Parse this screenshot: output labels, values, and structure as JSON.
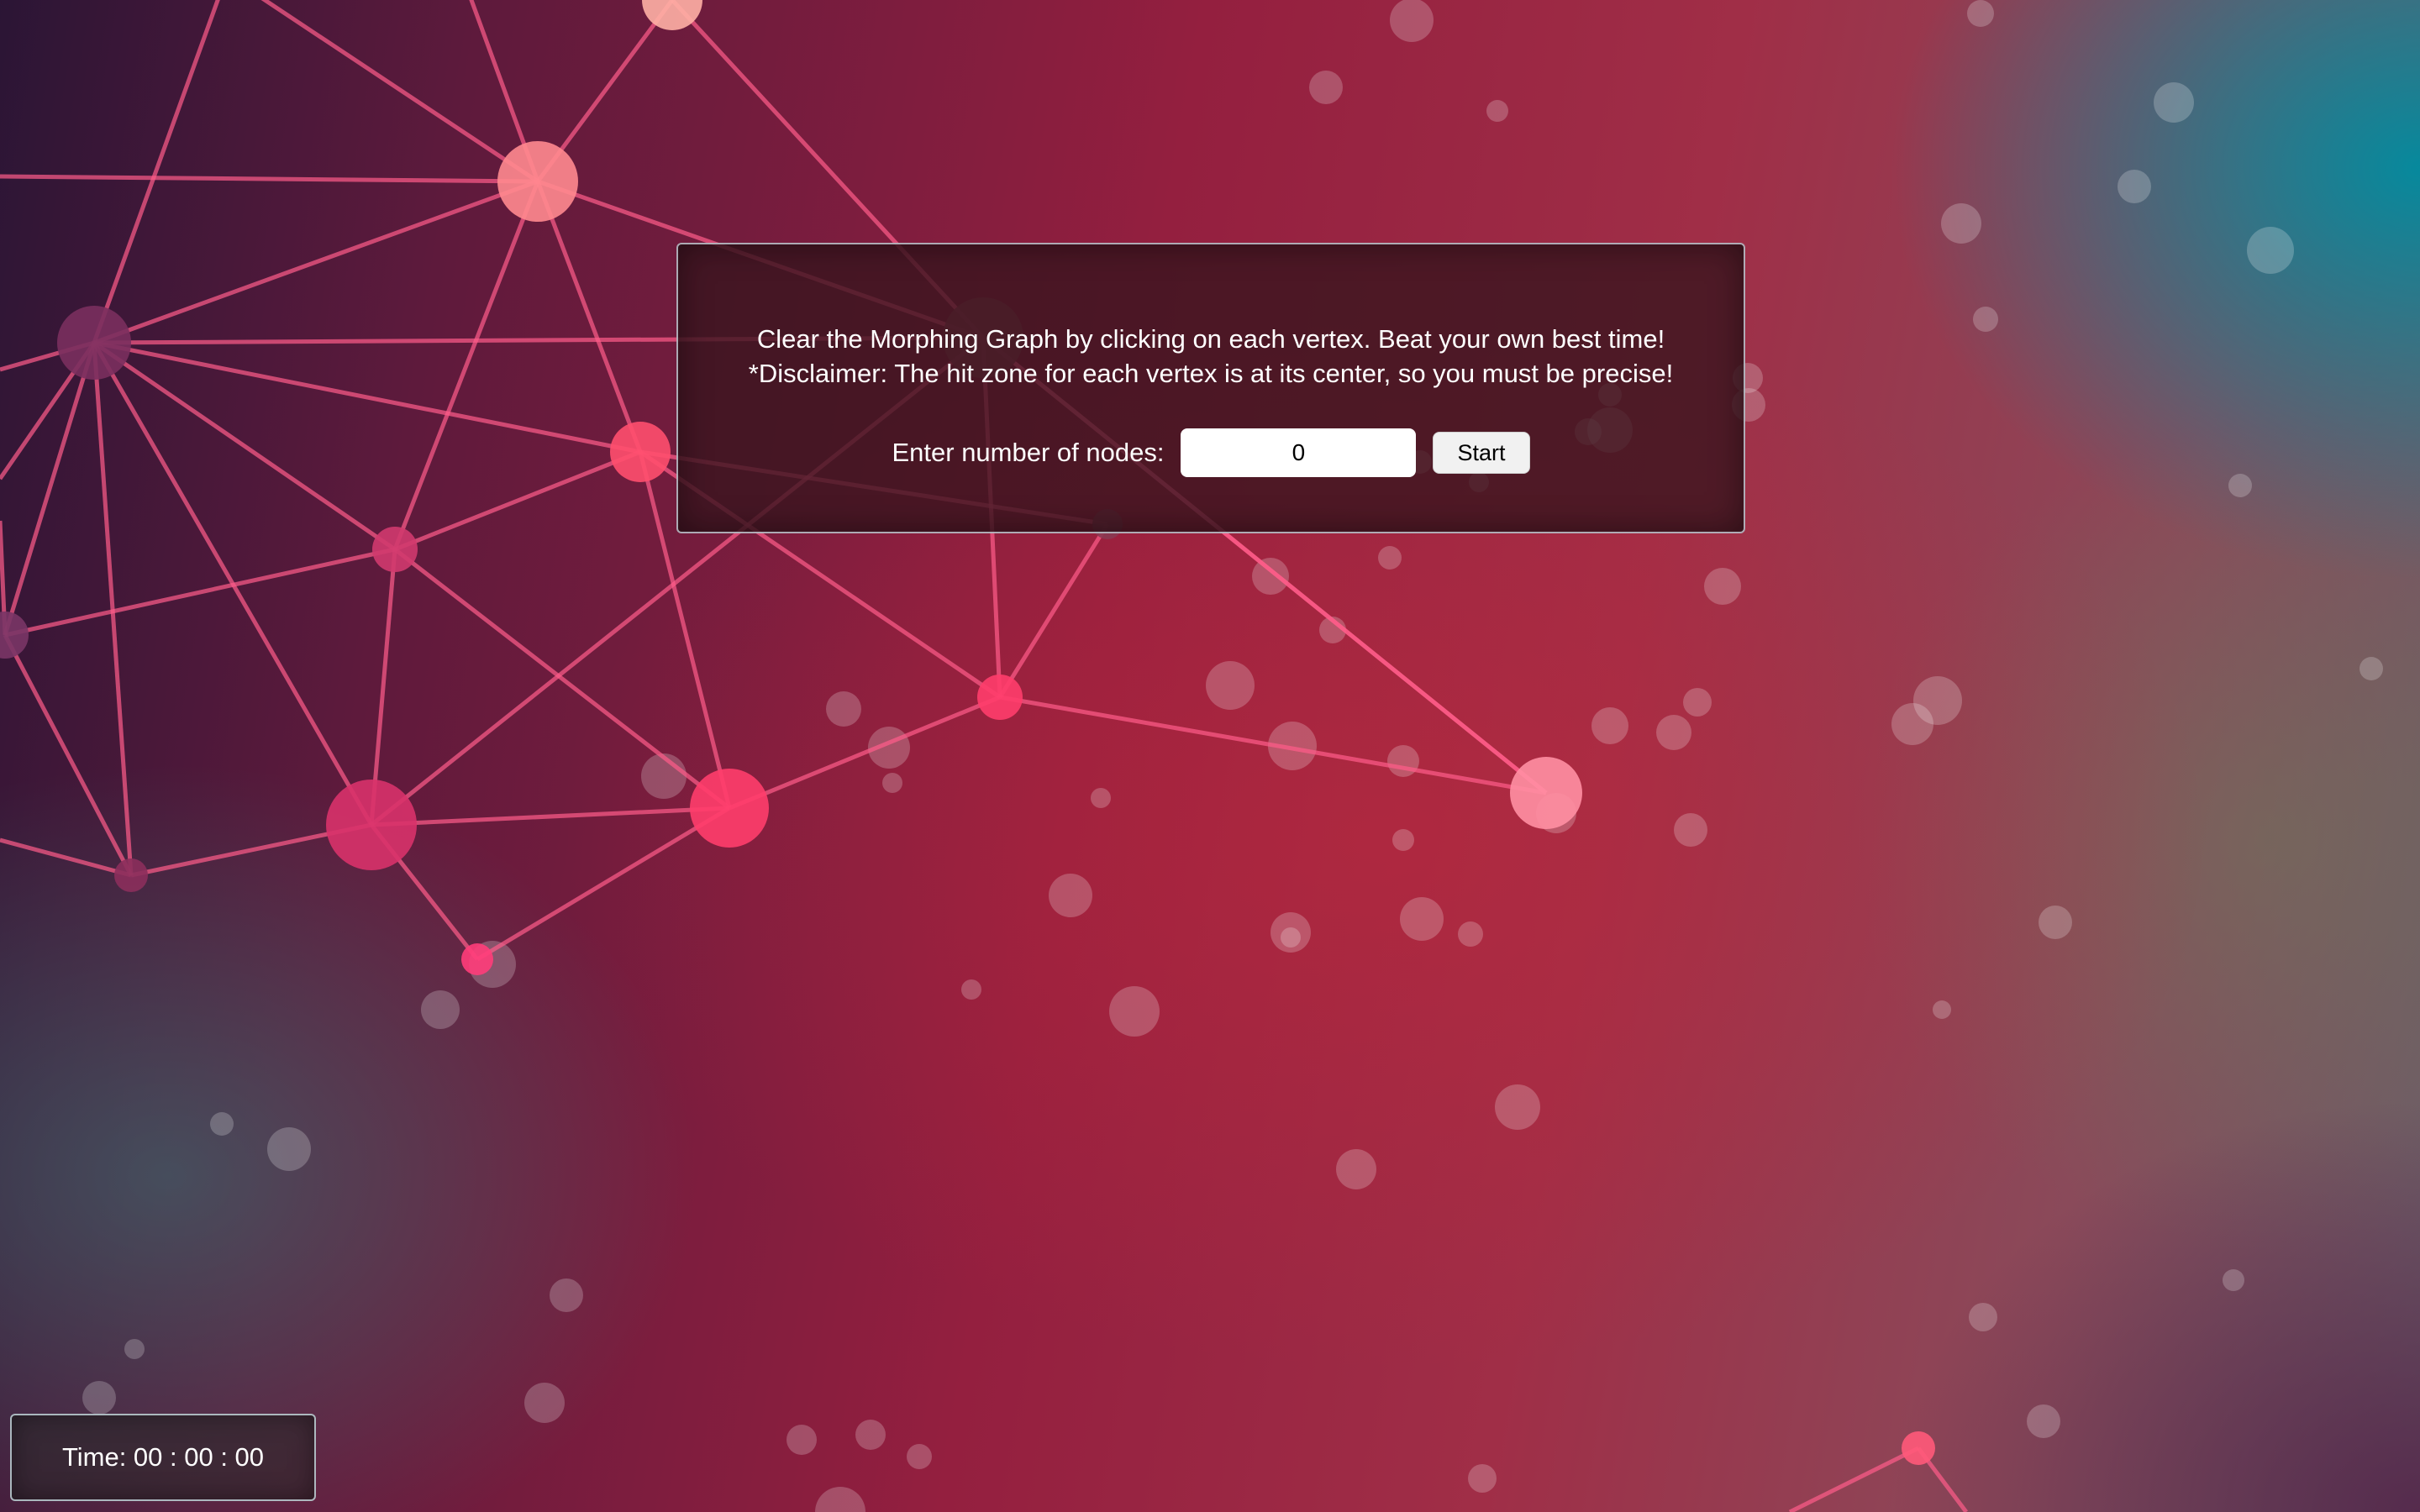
{
  "intro": {
    "line1": "Clear the Morphing Graph by clicking on each vertex. Beat your own best time!",
    "line2": "*Disclaimer: The hit zone for each vertex is at its center, so you must be precise!"
  },
  "controls": {
    "nodes_label": "Enter number of nodes:",
    "nodes_value": "0",
    "start_label": "Start"
  },
  "timer": {
    "text": "Time: 00 : 00 : 00"
  },
  "colors": {
    "edge": "#ff5c8a",
    "vertex": "#ff3d73",
    "panel_bg": "#37141e"
  }
}
